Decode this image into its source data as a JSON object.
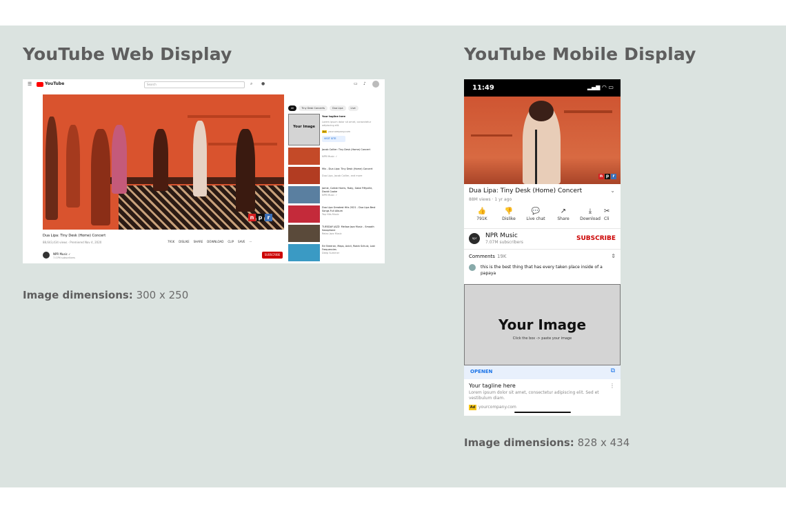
{
  "web_section": {
    "title": "YouTube Web Display",
    "dims_label": "Image dimensions:",
    "dims_value": "300 x 250"
  },
  "mobile_section": {
    "title": "YouTube Mobile Display",
    "dims_label": "Image dimensions:",
    "dims_value": "828 x 434"
  },
  "web": {
    "logo_text": "YouTube",
    "search_placeholder": "Search",
    "video_title": "Dua Lipa: Tiny Desk (Home) Concert",
    "video_meta": "88,643,434 views · Premiered Nov 4, 2020",
    "actions": [
      "791K",
      "DISLIKE",
      "SHARE",
      "DOWNLOAD",
      "CLIP",
      "SAVE",
      "···"
    ],
    "channel_name": "NPR Music ✓",
    "channel_subs": "7.07M subscribers",
    "subscribe_label": "SUBSCRIBE",
    "chips": [
      "All",
      "Tiny Desk Concerts",
      "Dua Lipa",
      "Live"
    ],
    "ad": {
      "thumb_title": "Your Image",
      "tagline": "Your tagline here",
      "lorem": "Lorem ipsum dolor sit amet, consectetur adipiscing elit.",
      "badge": "Ad",
      "company": "yourcompany.com",
      "visit_label": "VISIT SITE"
    },
    "related": [
      {
        "title": "Jacob Collier: Tiny Desk (Home) Concert",
        "meta": "NPR Music ✓"
      },
      {
        "title": "Mix - Dua Lipa: Tiny Desk (Home) Concert",
        "meta": "Dua Lipa, Jacob Collier, and more"
      },
      {
        "title": "Jamie, Colbie Harris, Ruby, Gabe Fiftyville, David Cooke",
        "meta": "NPR Music ✓"
      },
      {
        "title": "Dua Lipa Greatest Hits 2021 - Dua Lipa Best Songs Full Album",
        "meta": "Top Hits Music"
      },
      {
        "title": "TUESDAY JAZZ: Mellow Jazz Music - Smooth Saxophone",
        "meta": "Relax Jazz Music"
      },
      {
        "title": "Ed Sheeran, Maps, Avicii, Robin Schulz, Lost Frequencies",
        "meta": "Deep Summer"
      }
    ]
  },
  "mobile": {
    "status_time": "11:49",
    "status_icons": "▂▄▆ ◠ ▭",
    "video_title": "Dua Lipa: Tiny Desk (Home) Concert",
    "video_meta": "88M views · 1 yr ago",
    "actions": [
      {
        "icon": "👍",
        "label": "791K"
      },
      {
        "icon": "👎",
        "label": "Dislike"
      },
      {
        "icon": "💬",
        "label": "Live chat"
      },
      {
        "icon": "↗",
        "label": "Share"
      },
      {
        "icon": "⤓",
        "label": "Download"
      },
      {
        "icon": "✂",
        "label": "Cli"
      }
    ],
    "channel_name": "NPR Music",
    "channel_subs": "7.07M subscribers",
    "subscribe_label": "SUBSCRIBE",
    "comments_label": "Comments",
    "comments_count": "19K",
    "comment_text": "this is the best thing that has every taken place inside of a papaya",
    "ad": {
      "title": "Your Image",
      "subtitle": "Click the box -> paste your image",
      "open_label": "OPENEN",
      "tagline": "Your tagline here",
      "lorem": "Lorem ipsum dolor sit amet, consectetur adipiscing elit. Sed et vestibulum diam.",
      "badge": "Ad",
      "company": "yourcompany.com"
    }
  }
}
